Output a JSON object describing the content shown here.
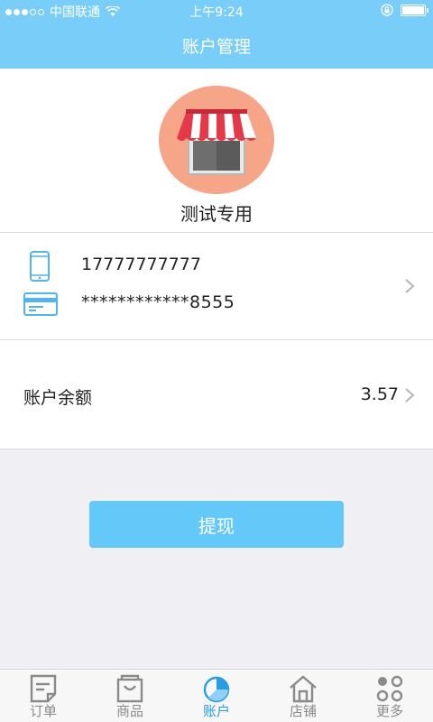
{
  "status_bar": {
    "carrier": "中国联通",
    "time": "上午9:24"
  },
  "nav": {
    "title": "账户管理"
  },
  "profile": {
    "shop_name": "测试专用",
    "avatar_color": "#f7a589"
  },
  "contact": {
    "phone": "17777777777",
    "card": "************8555"
  },
  "balance": {
    "label": "账户余额",
    "value": "3.57"
  },
  "withdraw": {
    "label": "提现",
    "color": "#64c8f8"
  },
  "tabs": [
    {
      "label": "订单",
      "icon": "document-icon",
      "active": false
    },
    {
      "label": "商品",
      "icon": "shopping-bag-icon",
      "active": false
    },
    {
      "label": "账户",
      "icon": "pie-chart-icon",
      "active": true
    },
    {
      "label": "店铺",
      "icon": "home-icon",
      "active": false
    },
    {
      "label": "更多",
      "icon": "more-dots-icon",
      "active": false
    }
  ],
  "colors": {
    "header": "#79cdf9",
    "active_tab": "#2a9de0",
    "inactive_tab": "#8a8a8a"
  }
}
